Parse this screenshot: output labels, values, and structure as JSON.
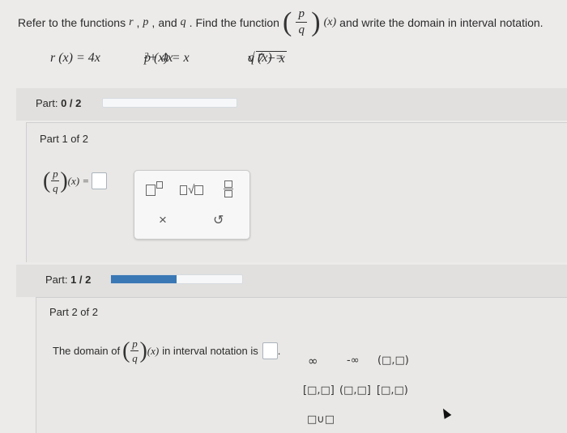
{
  "question": {
    "text_before": "Refer to the functions",
    "r": "r",
    "p": "p",
    "and": "and",
    "q": "q",
    "text_mid": ". Find the function",
    "fraction_num": "p",
    "fraction_den": "q",
    "arg": "(x)",
    "text_after": "and write the domain in interval notation."
  },
  "functions": {
    "r": "r (x) = 4x",
    "p_left": "p (x) = x",
    "p_exp": "2",
    "p_right": " + 4x",
    "q_left": "q (x) = ",
    "q_radicand": "7 − x"
  },
  "part_progress_1": {
    "label": "Part:",
    "value": "0 / 2",
    "fraction": 0
  },
  "part1": {
    "title": "Part 1 of 2",
    "lhs_num": "p",
    "lhs_den": "q",
    "lhs_arg": "(x) ="
  },
  "toolbox1": {
    "superscript": "superscript-icon",
    "sqrt": "square-root-icon",
    "fraction": "fraction-icon",
    "clear": "×",
    "undo": "↺"
  },
  "part_progress_2": {
    "label": "Part:",
    "value": "1 / 2",
    "fraction": 0.5
  },
  "part2": {
    "title": "Part 2 of 2",
    "text_before": "The domain of",
    "frac_num": "p",
    "frac_den": "q",
    "arg": "(x)",
    "text_after": "in interval notation is",
    "period": "."
  },
  "toolbox2": {
    "infinity": "∞",
    "neg_infinity": "-∞",
    "open_open": "(□,□)",
    "closed_closed": "[□,□]",
    "open_closed": "(□,□]",
    "closed_open": "[□,□)",
    "union": "□∪□"
  },
  "colors": {
    "progress_fill": "#3a78b5",
    "background": "#ecebea"
  }
}
